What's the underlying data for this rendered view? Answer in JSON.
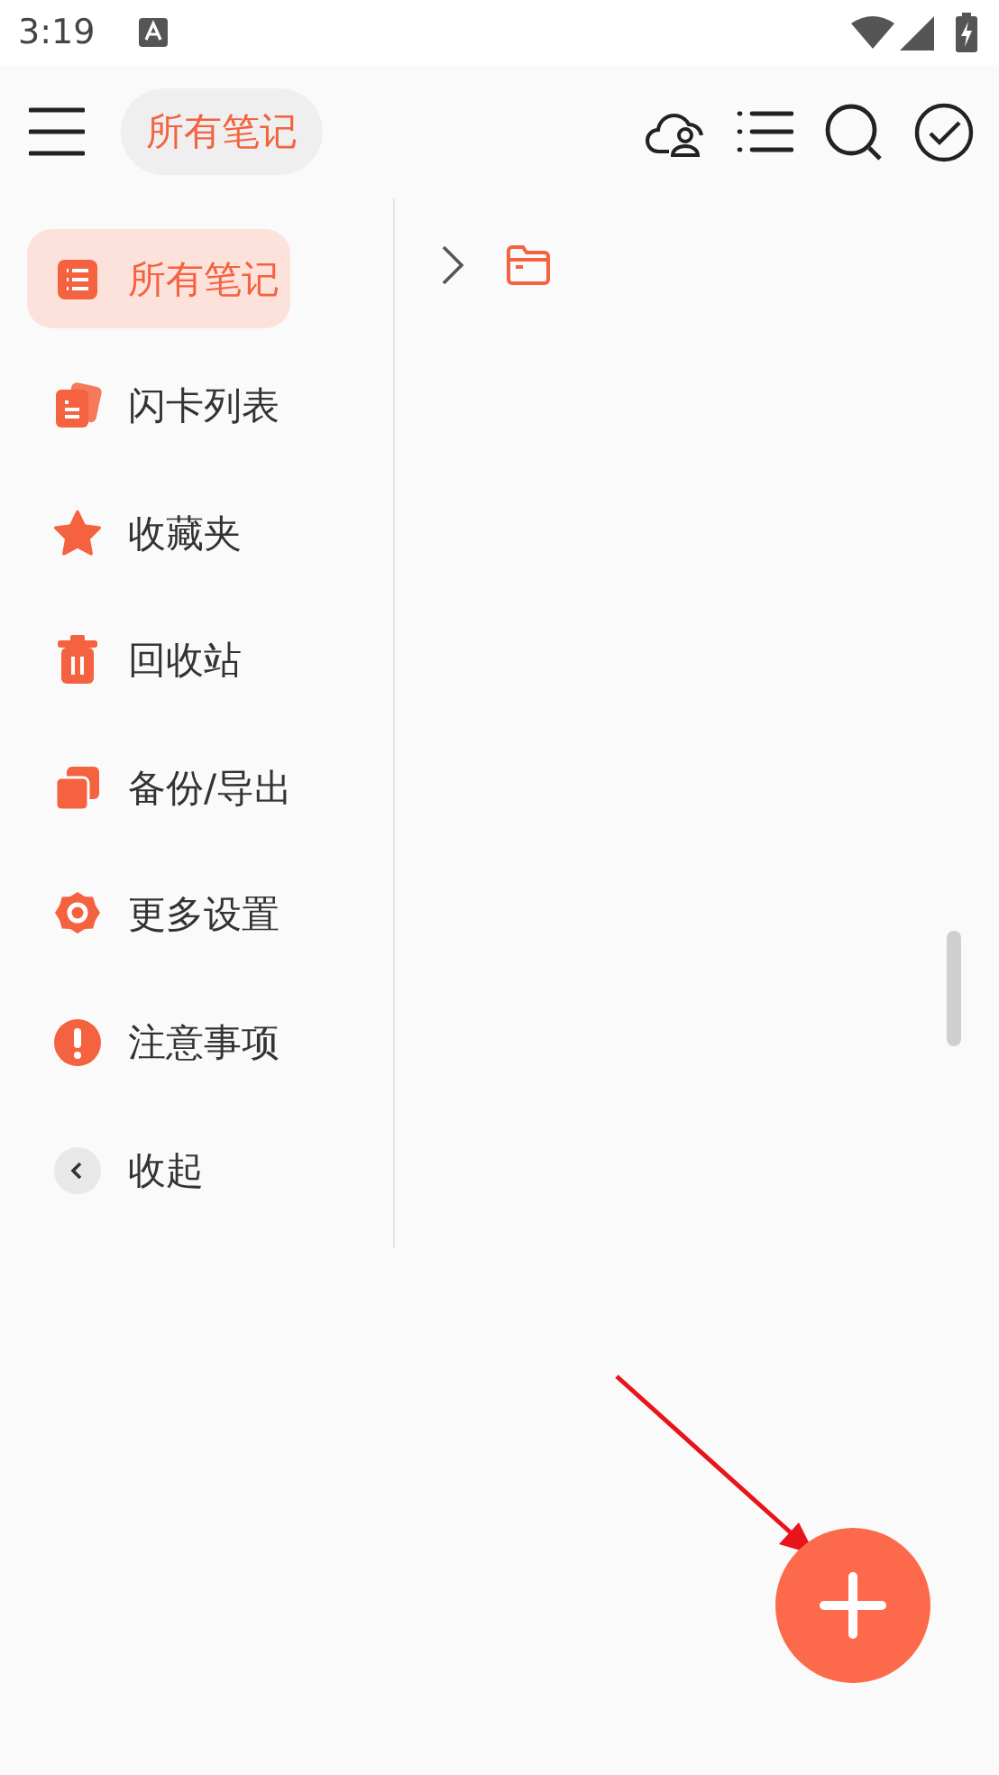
{
  "status_bar": {
    "time": "3:19"
  },
  "toolbar": {
    "title": "所有笔记"
  },
  "sidebar": {
    "items": [
      {
        "label": "所有笔记",
        "selected": true
      },
      {
        "label": "闪卡列表",
        "selected": false
      },
      {
        "label": "收藏夹",
        "selected": false
      },
      {
        "label": "回收站",
        "selected": false
      },
      {
        "label": "备份/导出",
        "selected": false
      },
      {
        "label": "更多设置",
        "selected": false
      },
      {
        "label": "注意事项",
        "selected": false
      },
      {
        "label": "收起",
        "selected": false
      }
    ]
  }
}
